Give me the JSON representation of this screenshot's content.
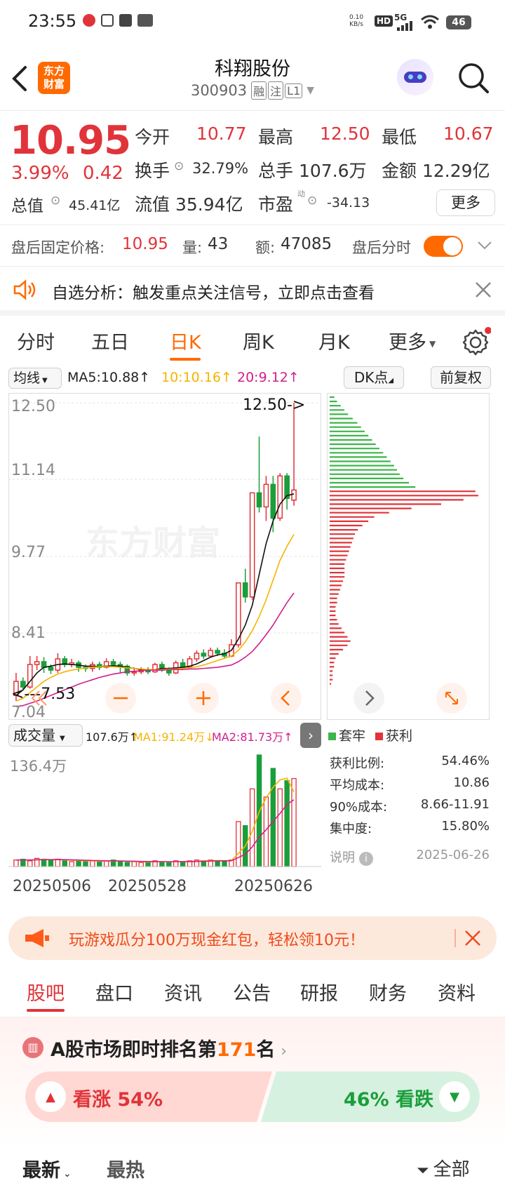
{
  "status_bar": {
    "time": "23:55",
    "net_speed_top": "0.10",
    "net_speed_bottom": "KB/s",
    "hd": "HD",
    "signal": "5G",
    "battery": "46"
  },
  "header": {
    "title": "科翔股份",
    "code": "300903",
    "tags": [
      "融",
      "注",
      "L1"
    ],
    "logo_top": "东方",
    "logo_bottom": "财富"
  },
  "quote": {
    "price": "10.95",
    "change_pct": "3.99%",
    "change": "0.42",
    "open_label": "今开",
    "open": "10.77",
    "high_label": "最高",
    "high": "12.50",
    "low_label": "最低",
    "low": "10.67",
    "turnover_label": "换手",
    "turnover": "32.79%",
    "volume_label": "总手",
    "volume": "107.6万",
    "amount_label": "金额",
    "amount": "12.29亿",
    "mktcap_label": "总值",
    "mktcap": "45.41亿",
    "float_label": "流值",
    "float_cap": "35.94亿",
    "pe_label": "市盈",
    "pe_sup": "动",
    "pe": "-34.13",
    "more_btn": "更多"
  },
  "after_hours": {
    "fixed_label": "盘后固定价格:",
    "fixed_price": "10.95",
    "qty_label": "量:",
    "qty": "43",
    "amt_label": "额:",
    "amt": "47085",
    "toggle_label": "盘后分时"
  },
  "notice": {
    "text": "自选分析：触发重点关注信号，立即点击查看"
  },
  "tabs": {
    "items": [
      "分时",
      "五日",
      "日K",
      "周K",
      "月K",
      "更多"
    ],
    "active": 2
  },
  "kline_header": {
    "ma_selector": "均线",
    "ma5": "MA5:10.88↑",
    "ma10": "10:10.16↑",
    "ma20": "20:9.12↑",
    "dk_btn": "DK点",
    "adjust_btn": "前复权"
  },
  "kline": {
    "y_labels": [
      "12.50",
      "11.14",
      "9.77",
      "8.41",
      "7.04"
    ],
    "max_label": "12.50->",
    "min_label": "<---7.53",
    "watermark": "东方财富"
  },
  "volume_header": {
    "selector": "成交量",
    "vol": "107.6万↑",
    "ma1": "MA1:91.24万↓",
    "ma2": "MA2:81.73万↑"
  },
  "volume": {
    "max_label": "136.4万",
    "dates": [
      "20250506",
      "20250528",
      "20250626"
    ]
  },
  "chips": {
    "legend_loss": "套牢",
    "legend_profit": "获利",
    "rows": [
      {
        "label": "获利比例:",
        "value": "54.46%"
      },
      {
        "label": "平均成本:",
        "value": "10.86"
      },
      {
        "label": "90%成本:",
        "value": "8.66-11.91"
      },
      {
        "label": "集中度:",
        "value": "15.80%"
      }
    ],
    "note_label": "说明",
    "note_date": "2025-06-26"
  },
  "promo": {
    "text": "玩游戏瓜分100万现金红包，轻松领10元！"
  },
  "subtabs": {
    "items": [
      "股吧",
      "盘口",
      "资讯",
      "公告",
      "研报",
      "财务",
      "资料"
    ],
    "active": 0
  },
  "rank": {
    "prefix": "A股市场即时排名第",
    "number": "171",
    "suffix": "名"
  },
  "vote": {
    "up_label": "看涨 54%",
    "down_label": "46% 看跌"
  },
  "feed": {
    "tab_latest": "最新",
    "tab_hot": "最热",
    "filter": "全部"
  },
  "colors": {
    "up": "#e0343a",
    "down": "#1a9e3b",
    "accent": "#ff6a00",
    "ma10": "#f5b400",
    "ma20": "#d21e8c"
  },
  "chart_data": [
    {
      "type": "candlestick",
      "title": "日K",
      "ylim": [
        7.04,
        12.5
      ],
      "x": [
        "20250506",
        "20250528",
        "20250626"
      ],
      "candles": [
        {
          "o": 7.3,
          "c": 7.55,
          "h": 7.7,
          "l": 7.2
        },
        {
          "o": 7.55,
          "c": 7.45,
          "h": 7.62,
          "l": 7.4
        },
        {
          "o": 7.45,
          "c": 7.85,
          "h": 8.0,
          "l": 7.42
        },
        {
          "o": 7.85,
          "c": 7.9,
          "h": 8.0,
          "l": 7.75
        },
        {
          "o": 7.9,
          "c": 7.8,
          "h": 7.98,
          "l": 7.7
        },
        {
          "o": 7.8,
          "c": 7.75,
          "h": 7.85,
          "l": 7.68
        },
        {
          "o": 7.75,
          "c": 7.95,
          "h": 8.05,
          "l": 7.7
        },
        {
          "o": 7.95,
          "c": 7.85,
          "h": 8.0,
          "l": 7.8
        },
        {
          "o": 7.85,
          "c": 7.88,
          "h": 7.95,
          "l": 7.8
        },
        {
          "o": 7.88,
          "c": 7.8,
          "h": 7.92,
          "l": 7.72
        },
        {
          "o": 7.8,
          "c": 7.78,
          "h": 7.85,
          "l": 7.72
        },
        {
          "o": 7.78,
          "c": 7.85,
          "h": 7.9,
          "l": 7.72
        },
        {
          "o": 7.85,
          "c": 7.8,
          "h": 7.9,
          "l": 7.75
        },
        {
          "o": 7.8,
          "c": 7.9,
          "h": 7.96,
          "l": 7.78
        },
        {
          "o": 7.9,
          "c": 7.85,
          "h": 7.95,
          "l": 7.8
        },
        {
          "o": 7.85,
          "c": 7.82,
          "h": 7.9,
          "l": 7.7
        },
        {
          "o": 7.82,
          "c": 7.7,
          "h": 7.85,
          "l": 7.65
        },
        {
          "o": 7.7,
          "c": 7.72,
          "h": 7.8,
          "l": 7.65
        },
        {
          "o": 7.72,
          "c": 7.75,
          "h": 7.8,
          "l": 7.68
        },
        {
          "o": 7.75,
          "c": 7.72,
          "h": 7.8,
          "l": 7.68
        },
        {
          "o": 7.72,
          "c": 7.85,
          "h": 7.88,
          "l": 7.7
        },
        {
          "o": 7.85,
          "c": 7.75,
          "h": 7.9,
          "l": 7.72
        },
        {
          "o": 7.75,
          "c": 7.7,
          "h": 7.8,
          "l": 7.65
        },
        {
          "o": 7.7,
          "c": 7.88,
          "h": 7.92,
          "l": 7.68
        },
        {
          "o": 7.88,
          "c": 7.8,
          "h": 7.95,
          "l": 7.75
        },
        {
          "o": 7.8,
          "c": 7.95,
          "h": 8.0,
          "l": 7.78
        },
        {
          "o": 7.95,
          "c": 8.05,
          "h": 8.1,
          "l": 7.9
        },
        {
          "o": 8.05,
          "c": 8.0,
          "h": 8.12,
          "l": 7.95
        },
        {
          "o": 8.0,
          "c": 8.1,
          "h": 8.15,
          "l": 7.98
        },
        {
          "o": 8.1,
          "c": 8.05,
          "h": 8.15,
          "l": 8.0
        },
        {
          "o": 8.05,
          "c": 8.0,
          "h": 8.12,
          "l": 7.95
        },
        {
          "o": 8.0,
          "c": 8.2,
          "h": 8.3,
          "l": 7.98
        },
        {
          "o": 8.2,
          "c": 9.3,
          "h": 9.3,
          "l": 8.15
        },
        {
          "o": 9.3,
          "c": 9.05,
          "h": 9.55,
          "l": 8.95
        },
        {
          "o": 9.05,
          "c": 10.9,
          "h": 10.9,
          "l": 9.0
        },
        {
          "o": 10.9,
          "c": 10.65,
          "h": 11.9,
          "l": 10.55
        },
        {
          "o": 10.65,
          "c": 11.05,
          "h": 11.2,
          "l": 10.4
        },
        {
          "o": 11.05,
          "c": 10.45,
          "h": 11.2,
          "l": 10.2
        },
        {
          "o": 10.45,
          "c": 11.2,
          "h": 11.25,
          "l": 10.4
        },
        {
          "o": 11.2,
          "c": 10.8,
          "h": 11.25,
          "l": 10.6
        },
        {
          "o": 10.77,
          "c": 10.95,
          "h": 12.5,
          "l": 10.67
        }
      ],
      "series": [
        {
          "name": "MA5",
          "values": [
            7.3,
            7.4,
            7.55,
            7.7,
            7.8,
            7.82,
            7.85,
            7.86,
            7.85,
            7.84,
            7.82,
            7.82,
            7.81,
            7.82,
            7.83,
            7.82,
            7.8,
            7.78,
            7.76,
            7.75,
            7.76,
            7.78,
            7.78,
            7.79,
            7.8,
            7.82,
            7.86,
            7.92,
            7.98,
            8.02,
            8.04,
            8.1,
            8.3,
            8.55,
            8.9,
            9.45,
            10.0,
            10.4,
            10.7,
            10.85,
            10.88
          ]
        },
        {
          "name": "10",
          "values": [
            7.2,
            7.25,
            7.35,
            7.45,
            7.55,
            7.62,
            7.68,
            7.72,
            7.75,
            7.77,
            7.79,
            7.8,
            7.81,
            7.81,
            7.81,
            7.8,
            7.79,
            7.78,
            7.77,
            7.76,
            7.76,
            7.76,
            7.77,
            7.77,
            7.78,
            7.79,
            7.81,
            7.84,
            7.88,
            7.92,
            7.96,
            8.0,
            8.1,
            8.25,
            8.45,
            8.7,
            9.0,
            9.35,
            9.7,
            9.95,
            10.16
          ]
        },
        {
          "name": "20",
          "values": [
            7.1,
            7.12,
            7.16,
            7.2,
            7.25,
            7.3,
            7.35,
            7.4,
            7.45,
            7.5,
            7.54,
            7.58,
            7.62,
            7.65,
            7.68,
            7.7,
            7.72,
            7.73,
            7.74,
            7.75,
            7.75,
            7.75,
            7.76,
            7.76,
            7.76,
            7.77,
            7.77,
            7.78,
            7.79,
            7.8,
            7.82,
            7.84,
            7.9,
            7.98,
            8.08,
            8.22,
            8.38,
            8.55,
            8.75,
            8.95,
            9.12
          ]
        }
      ]
    },
    {
      "type": "bar",
      "title": "成交量",
      "ylabel": "万",
      "ylim": [
        0,
        136.4
      ],
      "values": [
        8,
        9,
        7,
        10,
        9,
        8,
        9,
        7,
        6,
        7,
        6,
        7,
        6,
        7,
        8,
        6,
        5,
        6,
        5,
        6,
        7,
        6,
        5,
        7,
        6,
        7,
        8,
        7,
        8,
        7,
        6,
        8,
        55,
        50,
        95,
        136.4,
        85,
        120,
        95,
        105,
        107.6
      ],
      "up": [
        1,
        0,
        1,
        1,
        0,
        0,
        1,
        0,
        1,
        0,
        0,
        1,
        0,
        1,
        0,
        0,
        0,
        1,
        1,
        0,
        1,
        0,
        0,
        1,
        0,
        1,
        1,
        0,
        1,
        0,
        0,
        1,
        1,
        0,
        1,
        0,
        1,
        0,
        1,
        0,
        1
      ],
      "series": [
        {
          "name": "MA1",
          "values": [
            8,
            8,
            8,
            8.5,
            8.6,
            8.4,
            8.6,
            8.2,
            7.8,
            7.4,
            7,
            6.8,
            6.6,
            6.6,
            6.8,
            6.8,
            6.4,
            6.2,
            5.8,
            5.6,
            5.8,
            6,
            5.8,
            6,
            6.2,
            6.2,
            6.6,
            7,
            7.2,
            7.4,
            7.2,
            7.2,
            16,
            25,
            43,
            67,
            84,
            97,
            106,
            108,
            91.24
          ]
        },
        {
          "name": "MA2",
          "values": [
            8,
            8,
            8,
            8.2,
            8.4,
            8.4,
            8.5,
            8.4,
            8.2,
            8,
            7.7,
            7.4,
            7.2,
            7,
            6.9,
            6.8,
            6.6,
            6.5,
            6.3,
            6.2,
            6.1,
            6,
            6,
            6,
            6,
            6.1,
            6.3,
            6.5,
            6.7,
            6.9,
            7,
            7.1,
            11,
            15,
            24,
            36,
            45,
            55,
            65,
            76,
            81.73
          ]
        }
      ]
    },
    {
      "type": "bar",
      "title": "筹码分布",
      "note": "chip distribution by price level (relative length 0-1), top to bottom from 12.50 to 7.04",
      "loss_values": [
        0.05,
        0.08,
        0.12,
        0.16,
        0.2,
        0.25,
        0.3,
        0.34,
        0.38,
        0.42,
        0.46,
        0.5,
        0.54,
        0.58,
        0.62,
        0.66,
        0.7,
        0.73,
        0.76,
        0.8,
        0.86,
        0.93
      ],
      "profit_values": [
        0.98,
        1.0,
        0.9,
        0.75,
        0.55,
        0.4,
        0.3,
        0.26,
        0.22,
        0.19,
        0.17,
        0.16,
        0.15,
        0.14,
        0.13,
        0.12,
        0.11,
        0.1,
        0.1,
        0.1,
        0.1,
        0.09,
        0.08,
        0.07,
        0.06,
        0.05,
        0.05,
        0.04,
        0.04,
        0.04,
        0.05,
        0.06,
        0.08,
        0.1,
        0.12,
        0.14,
        0.12,
        0.09,
        0.06,
        0.04,
        0.03,
        0.03,
        0.02,
        0.02,
        0.02,
        0.01
      ]
    }
  ]
}
